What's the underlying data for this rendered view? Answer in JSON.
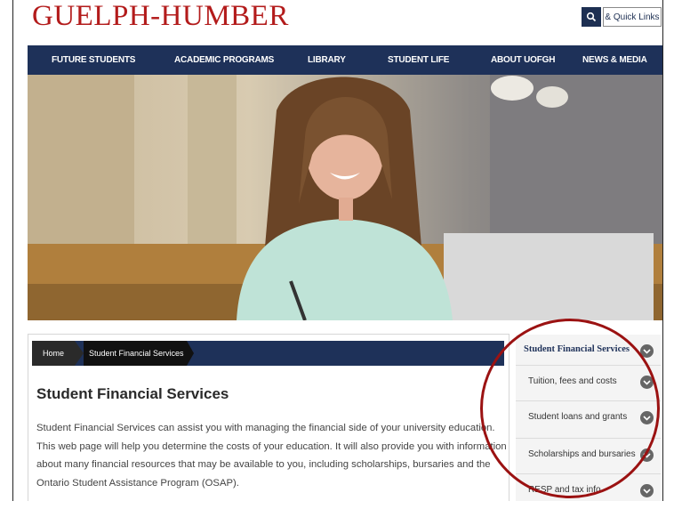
{
  "logo": "GUELPH-HUMBER",
  "header": {
    "search_icon": "search-icon",
    "quick_links": "& Quick Links"
  },
  "nav": {
    "items": [
      "FUTURE STUDENTS",
      "ACADEMIC PROGRAMS",
      "LIBRARY",
      "STUDENT LIFE",
      "ABOUT UOFGH",
      "NEWS & MEDIA"
    ]
  },
  "breadcrumb": {
    "home": "Home",
    "current": "Student Financial Services"
  },
  "main": {
    "title": "Student Financial Services",
    "body": "Student Financial Services can assist you with managing the financial side of your university education. This web page will help you determine the costs of your education. It will also provide you with information about many financial resources that may be available to you, including scholarships, bursaries and the Ontario Student Assistance Program (OSAP)."
  },
  "sidebar": {
    "header": "Student Financial Services",
    "items": [
      "Tuition, fees and costs",
      "Student loans and grants",
      "Scholarships and bursaries",
      "RESP and tax info"
    ]
  },
  "colors": {
    "brand_red": "#b31b1b",
    "nav_blue": "#1e3159",
    "annotation_circle": "#9b1212"
  }
}
